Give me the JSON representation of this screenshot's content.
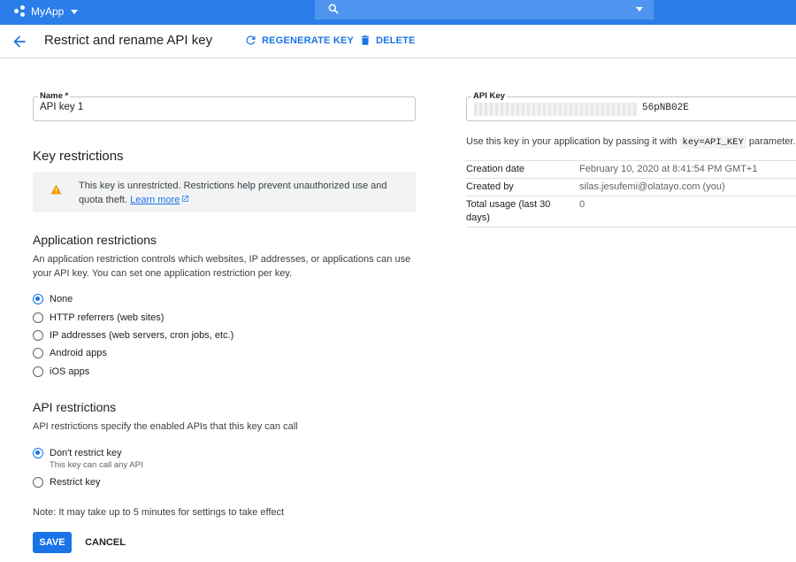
{
  "topbar": {
    "app_name": "MyApp",
    "search_placeholder": ""
  },
  "header": {
    "title": "Restrict and rename API key",
    "regenerate_label": "REGENERATE KEY",
    "delete_label": "DELETE"
  },
  "name_field": {
    "label": "Name *",
    "value": "API key 1"
  },
  "key_restrictions": {
    "heading": "Key restrictions",
    "warning_text": "This key is unrestricted. Restrictions help prevent unauthorized use and quota theft.",
    "learn_more": "Learn more"
  },
  "application_restrictions": {
    "heading": "Application restrictions",
    "description": "An application restriction controls which websites, IP addresses, or applications can use your API key. You can set one application restriction per key.",
    "options": [
      {
        "label": "None",
        "selected": true
      },
      {
        "label": "HTTP referrers (web sites)",
        "selected": false
      },
      {
        "label": "IP addresses (web servers, cron jobs, etc.)",
        "selected": false
      },
      {
        "label": "Android apps",
        "selected": false
      },
      {
        "label": "iOS apps",
        "selected": false
      }
    ]
  },
  "api_restrictions": {
    "heading": "API restrictions",
    "description": "API restrictions specify the enabled APIs that this key can call",
    "options": [
      {
        "label": "Don't restrict key",
        "sublabel": "This key can call any API",
        "selected": true
      },
      {
        "label": "Restrict key",
        "selected": false
      }
    ]
  },
  "note": "Note: It may take up to 5 minutes for settings to take effect",
  "buttons": {
    "save": "SAVE",
    "cancel": "CANCEL"
  },
  "api_key": {
    "label": "API Key",
    "visible_suffix": "56pNB02E",
    "hint_prefix": "Use this key in your application by passing it with",
    "hint_code": "key=API_KEY",
    "hint_suffix": "parameter."
  },
  "details": [
    {
      "key": "Creation date",
      "value": "February 10, 2020 at 8:41:54 PM GMT+1"
    },
    {
      "key": "Created by",
      "value": "silas.jesufemi@olatayo.com (you)"
    },
    {
      "key": "Total usage (last 30 days)",
      "value": "0"
    }
  ],
  "colors": {
    "topbar": "#2b7de9",
    "accent": "#1a73e8",
    "warning": "#f29900"
  }
}
